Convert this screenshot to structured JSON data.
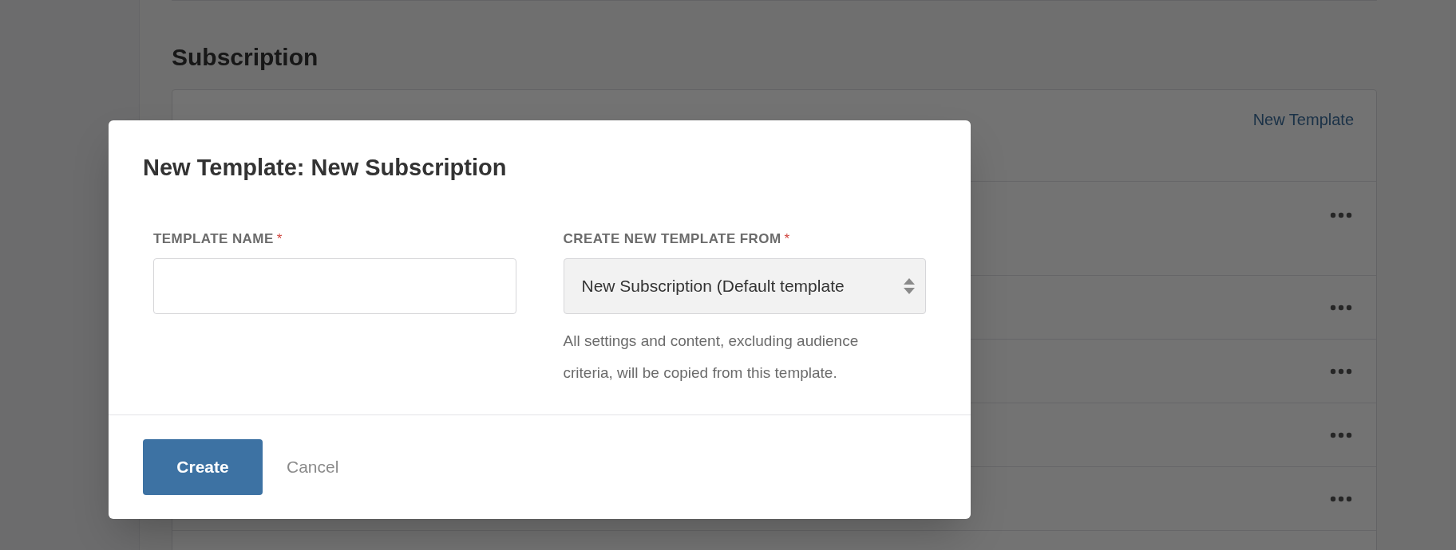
{
  "page": {
    "section_title": "Subscription",
    "card": {
      "link": "New Template"
    }
  },
  "modal": {
    "title": "New Template: New Subscription",
    "required_mark": "*",
    "fields": [
      {
        "kind": "text",
        "label": "TEMPLATE NAME",
        "required": true
      },
      {
        "kind": "select",
        "label": "CREATE NEW TEMPLATE FROM",
        "required": true,
        "value": "New Subscription (Default template",
        "help": "All settings and content, excluding audience criteria, will be copied from this template."
      }
    ],
    "buttons": [
      {
        "kind": "primary",
        "label": "Create"
      },
      {
        "kind": "link",
        "label": "Cancel"
      }
    ]
  }
}
